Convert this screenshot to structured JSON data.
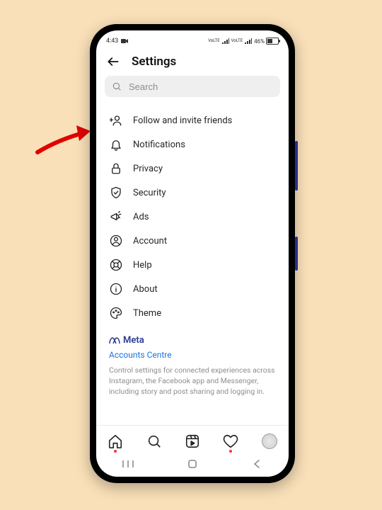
{
  "statusbar": {
    "time": "4:43",
    "battery_pct": "46%"
  },
  "header": {
    "title": "Settings"
  },
  "search": {
    "placeholder": "Search"
  },
  "settings": {
    "items": [
      {
        "label": "Follow and invite friends"
      },
      {
        "label": "Notifications"
      },
      {
        "label": "Privacy"
      },
      {
        "label": "Security"
      },
      {
        "label": "Ads"
      },
      {
        "label": "Account"
      },
      {
        "label": "Help"
      },
      {
        "label": "About"
      },
      {
        "label": "Theme"
      }
    ]
  },
  "meta": {
    "brand": "Meta",
    "accounts_link": "Accounts Centre",
    "description": "Control settings for connected experiences across Instagram, the Facebook app and Messenger, including story and post sharing and logging in."
  }
}
